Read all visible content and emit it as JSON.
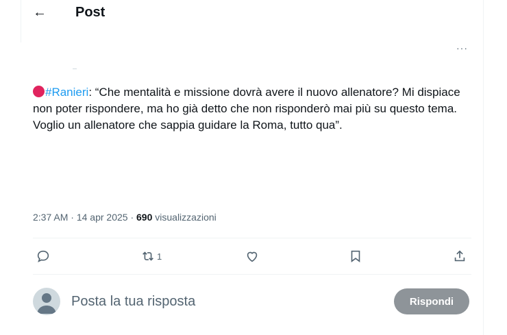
{
  "header": {
    "back_icon": "arrow-left-icon",
    "title": "Post"
  },
  "more_label": "···",
  "tweet": {
    "hashtag": "#Ranieri",
    "text": ": “Che mentalità e missione dovrà avere il nuovo allenatore? Mi dispiace non poter rispondere, ma ho già detto che non risponderò mai più su questo tema. Voglio un allenatore che sappia guidare la Roma, tutto qua”.",
    "dot_color": "#e0245e"
  },
  "meta": {
    "time": "2:37 AM",
    "sep1": " · ",
    "date": "14 apr 2025",
    "sep2": " · ",
    "views": "690",
    "views_label": " visualizzazioni"
  },
  "actions": {
    "reply_icon": "comment-icon",
    "repost_icon": "repost-icon",
    "repost_count": "1",
    "like_icon": "heart-icon",
    "bookmark_icon": "bookmark-icon",
    "share_icon": "share-icon"
  },
  "reply_box": {
    "placeholder": "Posta la tua risposta",
    "button": "Rispondi"
  },
  "colors": {
    "accent": "#1d9bf0",
    "muted": "#536471",
    "button_disabled": "#8e9499"
  }
}
